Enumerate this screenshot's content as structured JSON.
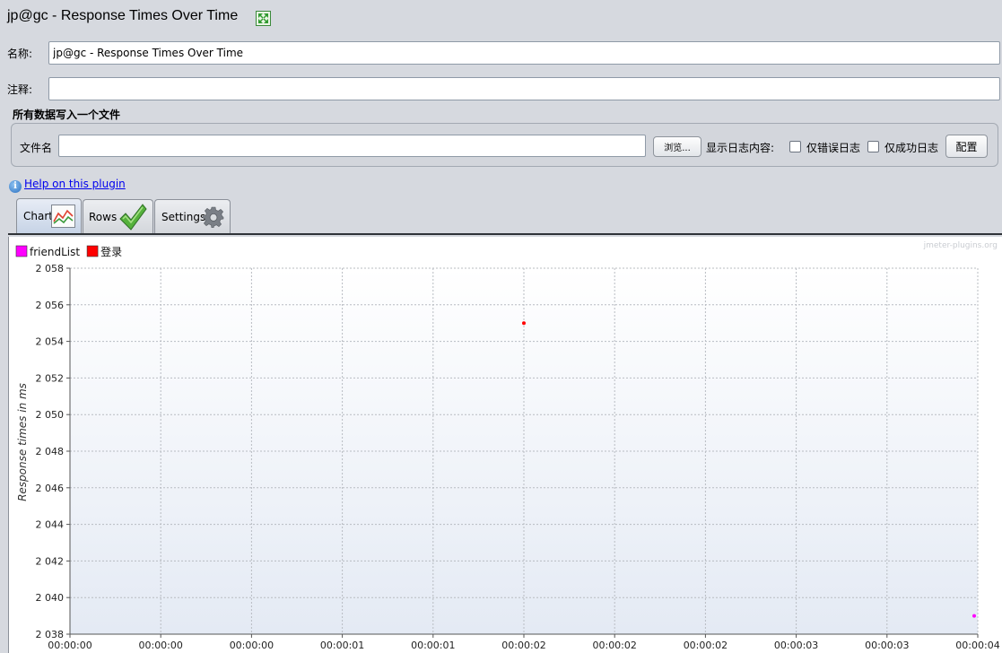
{
  "window": {
    "title": "jp@gc - Response Times Over Time"
  },
  "form": {
    "name_label": "名称:",
    "name_value": "jp@gc - Response Times Over Time",
    "comment_label": "注释:",
    "comment_value": ""
  },
  "file_group": {
    "title": "所有数据写入一个文件",
    "filename_label": "文件名",
    "filename_value": "",
    "browse_label": "浏览...",
    "log_content_label": "显示日志内容:",
    "errors_only_label": "仅错误日志",
    "errors_only_checked": false,
    "success_only_label": "仅成功日志",
    "success_only_checked": false,
    "configure_label": "配置"
  },
  "help": {
    "link_text": "Help on this plugin",
    "icon": "info-icon"
  },
  "tabs": [
    {
      "label": "Chart",
      "icon": "chart-icon",
      "selected": true
    },
    {
      "label": "Rows",
      "icon": "checkmark-icon",
      "selected": false
    },
    {
      "label": "Settings",
      "icon": "gear-icon",
      "selected": false
    }
  ],
  "chart_data": {
    "type": "scatter",
    "title": "",
    "watermark": "jmeter-plugins.org",
    "xlabel": "",
    "ylabel": "Response times in ms",
    "xlim": [
      "00:00:00",
      "00:00:04"
    ],
    "ylim": [
      2038,
      2058
    ],
    "y_ticks": [
      "2 038",
      "2 040",
      "2 042",
      "2 044",
      "2 046",
      "2 048",
      "2 050",
      "2 052",
      "2 054",
      "2 056",
      "2 058"
    ],
    "x_ticks": [
      "00:00:00",
      "00:00:00",
      "00:00:00",
      "00:00:01",
      "00:00:01",
      "00:00:02",
      "00:00:02",
      "00:00:02",
      "00:00:03",
      "00:00:03",
      "00:00:04"
    ],
    "grid": true,
    "legend_position": "top-left",
    "series": [
      {
        "name": "friendList",
        "color": "#ff00ff",
        "points": [
          {
            "x": "00:00:04",
            "y": 2039
          }
        ]
      },
      {
        "name": "登录",
        "color": "#ff0000",
        "points": [
          {
            "x": "00:00:02",
            "y": 2055
          }
        ]
      }
    ]
  }
}
